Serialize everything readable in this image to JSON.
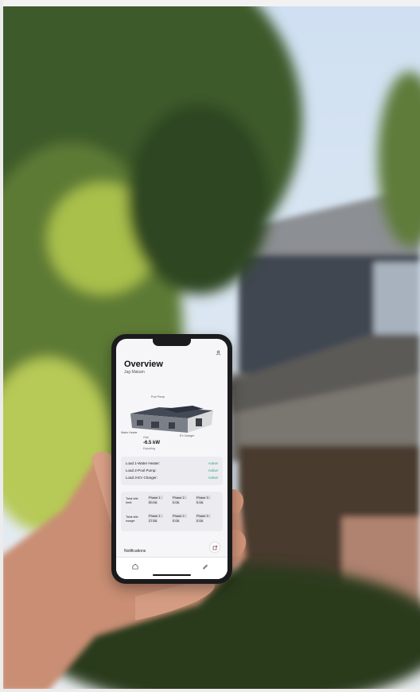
{
  "app": {
    "title": "Overview",
    "user": "Jag Makam"
  },
  "house": {
    "pool_label": "Pool Pump",
    "water_label": "Water Heater",
    "ev_label": "EV Charger",
    "grid_label": "Grid",
    "power": "-6.5 kW",
    "exporting": "Exporting"
  },
  "loads": [
    {
      "label": "Load 1-Water Heater:",
      "status": "Active"
    },
    {
      "label": "Load 2-Pool Pump:",
      "status": "Active"
    },
    {
      "label": "Load 3-EV Charger:",
      "status": "Active"
    }
  ],
  "limits": {
    "limit_label_1": "Total site",
    "limit_label_2": "limit:",
    "usage_label_1": "Total site",
    "usage_label_2": "usage:",
    "phases": [
      "Phase 1 :",
      "Phase 2 :",
      "Phase 3 :"
    ],
    "limit_values": [
      "50.0A",
      "0.0A",
      "0.0A"
    ],
    "usage_values": [
      "27.6A",
      "0.0A",
      "0.0A"
    ]
  },
  "notifications_label": "Notifications",
  "icons": [
    "account-icon",
    "home-icon",
    "settings-icon",
    "notification-icon"
  ],
  "colors": {
    "active": "#29a36a",
    "background": "#f6f6f8"
  }
}
